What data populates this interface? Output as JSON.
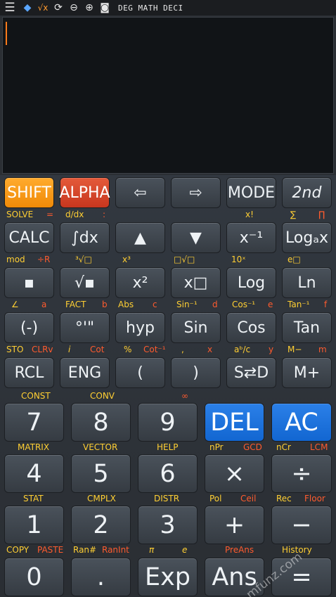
{
  "status_bar": {
    "icons": [
      "menu-icon",
      "diamond-icon",
      "sqrt-icon",
      "refresh-icon",
      "minus-circle-icon",
      "plus-circle-icon",
      "camera-icon"
    ],
    "sqrt_text": "√x",
    "indicators": "DEG MATH DECI"
  },
  "colors": {
    "shift": "#f59a12",
    "alpha": "#d0442a",
    "blue": "#1a6fdc",
    "yellow_label": "#ffcf33",
    "red_label": "#ff5b2e"
  },
  "keys": {
    "shift": "SHIFT",
    "alpha": "ALPHA",
    "left": "⇦",
    "right": "⇨",
    "mode": "MODE",
    "second": "2nd",
    "calc": "CALC",
    "integral": "∫dx",
    "up": "▲",
    "down": "▼",
    "inverse": "x⁻¹",
    "loga": "Logₐx",
    "fraction": "▪",
    "sqrt": "√▪",
    "square": "x²",
    "power": "x□",
    "log": "Log",
    "ln": "Ln",
    "neg": "(-)",
    "degmin": "°'\"",
    "hyp": "hyp",
    "sin": "Sin",
    "cos": "Cos",
    "tan": "Tan",
    "rcl": "RCL",
    "eng": "ENG",
    "lparen": "(",
    "rparen": ")",
    "sd": "S⇄D",
    "mplus": "M+",
    "n7": "7",
    "n8": "8",
    "n9": "9",
    "del": "DEL",
    "ac": "AC",
    "n4": "4",
    "n5": "5",
    "n6": "6",
    "times": "×",
    "divide": "÷",
    "n1": "1",
    "n2": "2",
    "n3": "3",
    "plus": "+",
    "minus": "−",
    "n0": "0",
    "dot": ".",
    "exp": "Exp",
    "ans": "Ans",
    "equals": "="
  },
  "labels": {
    "row1": {
      "solve": "SOLVE",
      "eq": "=",
      "ddx": "d/dx",
      "colon": ":",
      "xfact": "x!",
      "sum": "∑",
      "prod": "∏"
    },
    "row2": {
      "mod": "mod",
      "divr": "÷R",
      "cuberoot": "³√□",
      "cube": "x³",
      "nroot": "□√□",
      "tenx": "10ˣ",
      "ex": "e□"
    },
    "row3": {
      "angle": "∠",
      "a": "a",
      "fact": "FACT",
      "b": "b",
      "abs": "Abs",
      "c": "c",
      "asin": "Sin⁻¹",
      "d": "d",
      "acos": "Cos⁻¹",
      "e": "e",
      "atan": "Tan⁻¹",
      "f": "f"
    },
    "row4": {
      "sto": "STO",
      "clrv": "CLRv",
      "i": "i",
      "cot": "Cot",
      "percent": "%",
      "acot": "Cot⁻¹",
      "comma": ",",
      "x": "x",
      "abc": "aᵇ/c",
      "y": "y",
      "mminus": "M−",
      "m": "m"
    },
    "row5": {
      "const": "CONST",
      "conv": "CONV",
      "inf": "∞"
    },
    "row6": {
      "matrix": "MATRIX",
      "vector": "VECTOR",
      "help": "HELP",
      "npr": "nPr",
      "gcd": "GCD",
      "ncr": "nCr",
      "lcm": "LCM"
    },
    "row7": {
      "stat": "STAT",
      "cmplx": "CMPLX",
      "distr": "DISTR",
      "pol": "Pol",
      "ceil": "Ceil",
      "rec": "Rec",
      "floor": "Floor"
    },
    "row8": {
      "copy": "COPY",
      "paste": "PASTE",
      "ran": "Ran#",
      "ranint": "RanInt",
      "pi": "π",
      "e": "e",
      "preans": "PreAns",
      "history": "History"
    }
  },
  "watermark": "mfunz.com"
}
